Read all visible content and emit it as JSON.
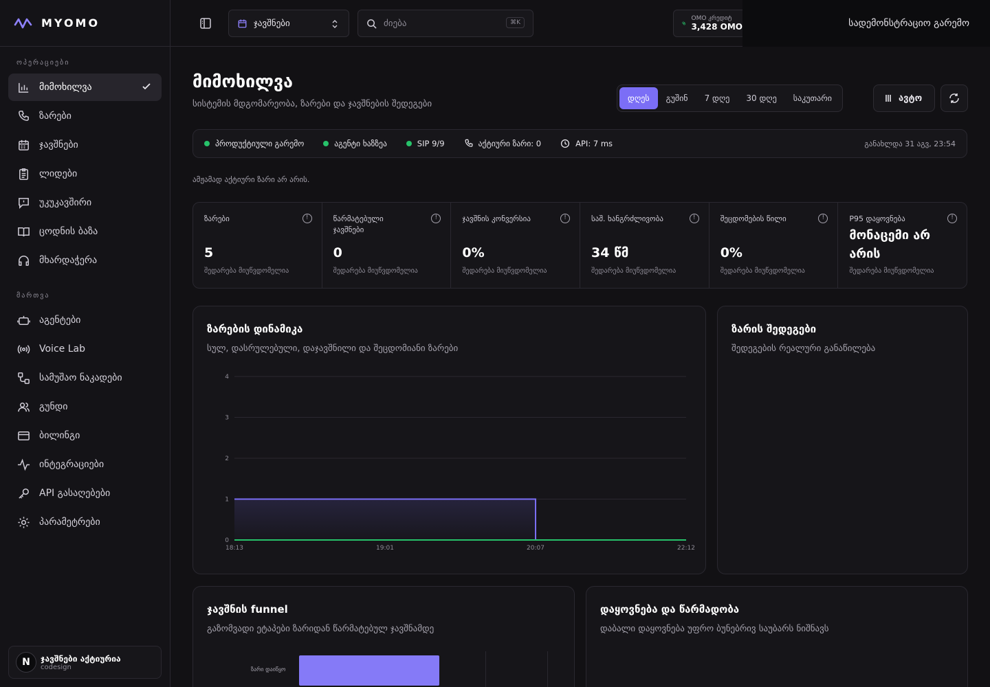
{
  "app": {
    "logo_text": "MYOMO"
  },
  "sidebar": {
    "section1": "ოპერაციები",
    "section2": "მართვა",
    "items1": [
      {
        "label": "მიმოხილვა",
        "icon": "bar-chart-icon"
      },
      {
        "label": "ზარები",
        "icon": "phone-icon"
      },
      {
        "label": "ჯავშნები",
        "icon": "calendar-icon"
      },
      {
        "label": "ლიდები",
        "icon": "clipboard-icon"
      },
      {
        "label": "უკუკავშირი",
        "icon": "feedback-icon"
      },
      {
        "label": "ცოდნის ბაზა",
        "icon": "book-icon"
      },
      {
        "label": "მხარდაჭერა",
        "icon": "headset-icon"
      }
    ],
    "items2": [
      {
        "label": "აგენტები",
        "icon": "bot-icon"
      },
      {
        "label": "Voice Lab",
        "icon": "broadcast-icon"
      },
      {
        "label": "სამუშაო ნაკადები",
        "icon": "workflow-icon"
      },
      {
        "label": "გუნდი",
        "icon": "users-icon"
      },
      {
        "label": "ბილინგი",
        "icon": "card-icon"
      },
      {
        "label": "ინტეგრაციები",
        "icon": "activity-icon"
      },
      {
        "label": "API გასაღებები",
        "icon": "key-icon"
      },
      {
        "label": "პარამეტრები",
        "icon": "gear-icon"
      }
    ],
    "org": {
      "initial": "N",
      "title": "ჯავშნები აქტიურია",
      "subtitle": "codesign"
    }
  },
  "topbar": {
    "select_value": "ჯავშნები",
    "search_placeholder": "ძიება",
    "search_shortcut": "⌘K",
    "balance_label": "OMO კრედიტ",
    "balance_value": "3,428 OMO",
    "admin_env": "სადემონსტრაციო გარემო"
  },
  "page": {
    "title": "მიმოხილვა",
    "subtitle": "სისტემის მდგომარეობა, ზარები და ჯავშნების შედეგები",
    "ranges": [
      "დღეს",
      "გუშინ",
      "7 დღე",
      "30 დღე",
      "საკუთარი"
    ],
    "auto_label": "ავტო",
    "status": {
      "env": "პროდუქტიული გარემო",
      "agent": "აგენტი ხაზზეა",
      "sip": "SIP 9/9",
      "active_calls": "აქტიური ზარი: 0",
      "api": "API: 7 ms",
      "updated": "განახლდა 31 აგვ, 23:54"
    },
    "note": "ამჟამად აქტიური ზარი არ არის."
  },
  "kpis": [
    {
      "label": "ზარები",
      "value": "5",
      "foot": "შედარება მიუწვდომელია"
    },
    {
      "label": "წარმატებული ჯავშნები",
      "value": "0",
      "foot": "შედარება მიუწვდომელია"
    },
    {
      "label": "ჯავშნის კონვერსია",
      "value": "0%",
      "foot": "შედარება მიუწვდომელია"
    },
    {
      "label": "საშ. ხანგრძლივობა",
      "value": "34 წმ",
      "foot": "შედარება მიუწვდომელია"
    },
    {
      "label": "შეცდომების წილი",
      "value": "0%",
      "foot": "შედარება მიუწვდომელია"
    },
    {
      "label": "P95 დაყოვნება",
      "value": "მონაცემი არ არის",
      "foot": "შედარება მიუწვდომელია"
    }
  ],
  "cards": {
    "dynamics": {
      "title": "ზარების დინამიკა",
      "desc": "სულ, დასრულებული, დაჯავშნილი და შეცდომიანი ზარები"
    },
    "outcomes": {
      "title": "ზარის შედეგები",
      "desc": "შედეგების რეალური განაწილება"
    },
    "funnel": {
      "title": "ჯავშნის funnel",
      "desc": "გაზომვადი ეტაპები ზარიდან წარმატებულ ჯავშნამდე",
      "bar_label": "ზარი დაიწყო"
    },
    "latency": {
      "title": "დაყოვნება და წარმადობა",
      "desc": "დაბალი დაყოვნება უფრო ბუნებრივ საუბარს ნიშნავს"
    }
  },
  "chart_data": {
    "type": "area",
    "x": [
      "18:13",
      "19:01",
      "20:07",
      "22:12"
    ],
    "yticks": [
      0,
      1,
      2,
      3,
      4
    ],
    "ylim": [
      0,
      4
    ],
    "series": [
      {
        "color": "#7b6ef6",
        "values": [
          1,
          1,
          0,
          0
        ]
      },
      {
        "color": "#27c26a",
        "values": [
          0,
          0,
          0,
          0
        ]
      }
    ]
  }
}
